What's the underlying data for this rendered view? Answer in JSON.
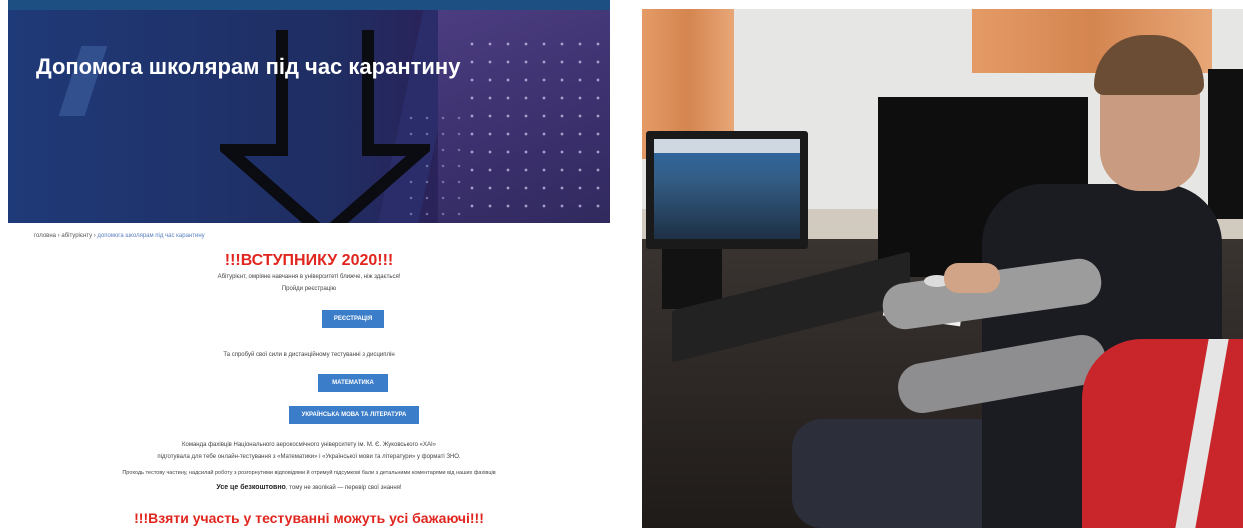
{
  "website": {
    "hero_title": "Допомога школярам під час карантину",
    "breadcrumb": {
      "home": "головна",
      "sep1": " › ",
      "section": "абітурієнту",
      "sep2": " › ",
      "current": "допомога школярам під час карантину"
    },
    "heading": "!!!ВСТУПНИКУ 2020!!!",
    "intro": "Абітурієнт, омріяне навчання в університеті ближче, ніж здається!",
    "cta_text": "Пройди реєстрацію",
    "register_button": "Реєстрація",
    "try_text": "Та спробуй свої сили в дистанційному тестуванні з дисциплін",
    "math_button": "Математика",
    "ukr_button": "Українська мова та література",
    "team_text": "Команда фахівців Національного аерокосмічного університету ім. М. Є. Жуковського «ХАІ»",
    "prepared_text": "підготувала для тебе онлайн-тестування з «Математики» і «Української мови та літератури» у форматі ЗНО.",
    "process_text": "Проходь тестову частину, надсилай роботу з розгорнутими відповідями й отримуй підсумкові бали з детальними коментарями від наших фахівців",
    "free_text_bold": "Усе це безкоштовно",
    "free_text_rest": ", тому не зволікай — перевір свої знання!",
    "bottom_heading": "!!!Взяти участь у тестуванні можуть усі бажаючі!!!"
  },
  "colors": {
    "accent_red": "#e0261f",
    "button_blue": "#3b7dc9",
    "hero_navy": "#1f3a78"
  },
  "photo": {
    "subject": "student at computer"
  }
}
